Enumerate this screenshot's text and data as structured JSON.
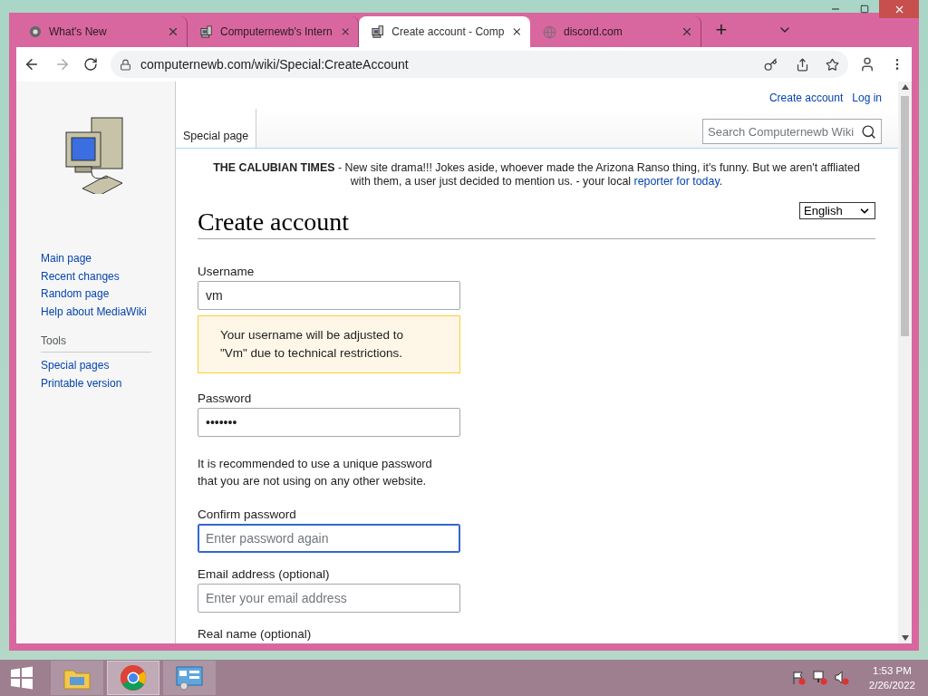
{
  "browser": {
    "tabs": [
      {
        "title": "What's New",
        "selected": false
      },
      {
        "title": "Computernewb's Intern",
        "selected": false
      },
      {
        "title": "Create account - Comp",
        "selected": true
      },
      {
        "title": "discord.com",
        "selected": false
      }
    ],
    "new_tab": "+",
    "address": "computernewb.com/wiki/Special:CreateAccount"
  },
  "wiki": {
    "personal_links": [
      "Create account",
      "Log in"
    ],
    "page_tab": {
      "label": "Special page",
      "selected": true
    },
    "search": {
      "placeholder": "Search Computernewb Wiki"
    },
    "nav": [
      "Main page",
      "Recent changes",
      "Random page",
      "Help about MediaWiki"
    ],
    "tools_heading": "Tools",
    "tools": [
      "Special pages",
      "Printable version"
    ],
    "banner": {
      "text": "**THE CALUBIAN TIMES** - New site drama!!! Jokes aside, whoever made the Arizona Ranso thing, it's funny. But we aren't affliated with them, a user just decided to mention us. - your local",
      "link": "reporter for today",
      "end": "."
    },
    "heading": "Create account",
    "language": "English",
    "fields": [
      {
        "kind": "input",
        "label": "Username",
        "value": "vm",
        "focused": false
      },
      {
        "kind": "notice",
        "text": "Your username will be adjusted to \"Vm\" due to technical restrictions."
      },
      {
        "kind": "input",
        "label": "Password",
        "value": "•••••••",
        "focused": false
      },
      {
        "kind": "help",
        "text": "It is recommended to use a unique password that you are not using on any other website."
      },
      {
        "kind": "input",
        "label": "Confirm password",
        "placeholder": "Enter password again",
        "focused": true
      },
      {
        "kind": "input",
        "label": "Email address (optional)",
        "placeholder": "Enter your email address",
        "focused": false
      },
      {
        "kind": "label",
        "label": "Real name (optional)"
      }
    ]
  },
  "taskbar": {
    "apps": [
      {
        "selected": false
      },
      {
        "selected": true
      },
      {
        "selected": false
      }
    ],
    "time": "1:53 PM",
    "date": "2/26/2022"
  }
}
